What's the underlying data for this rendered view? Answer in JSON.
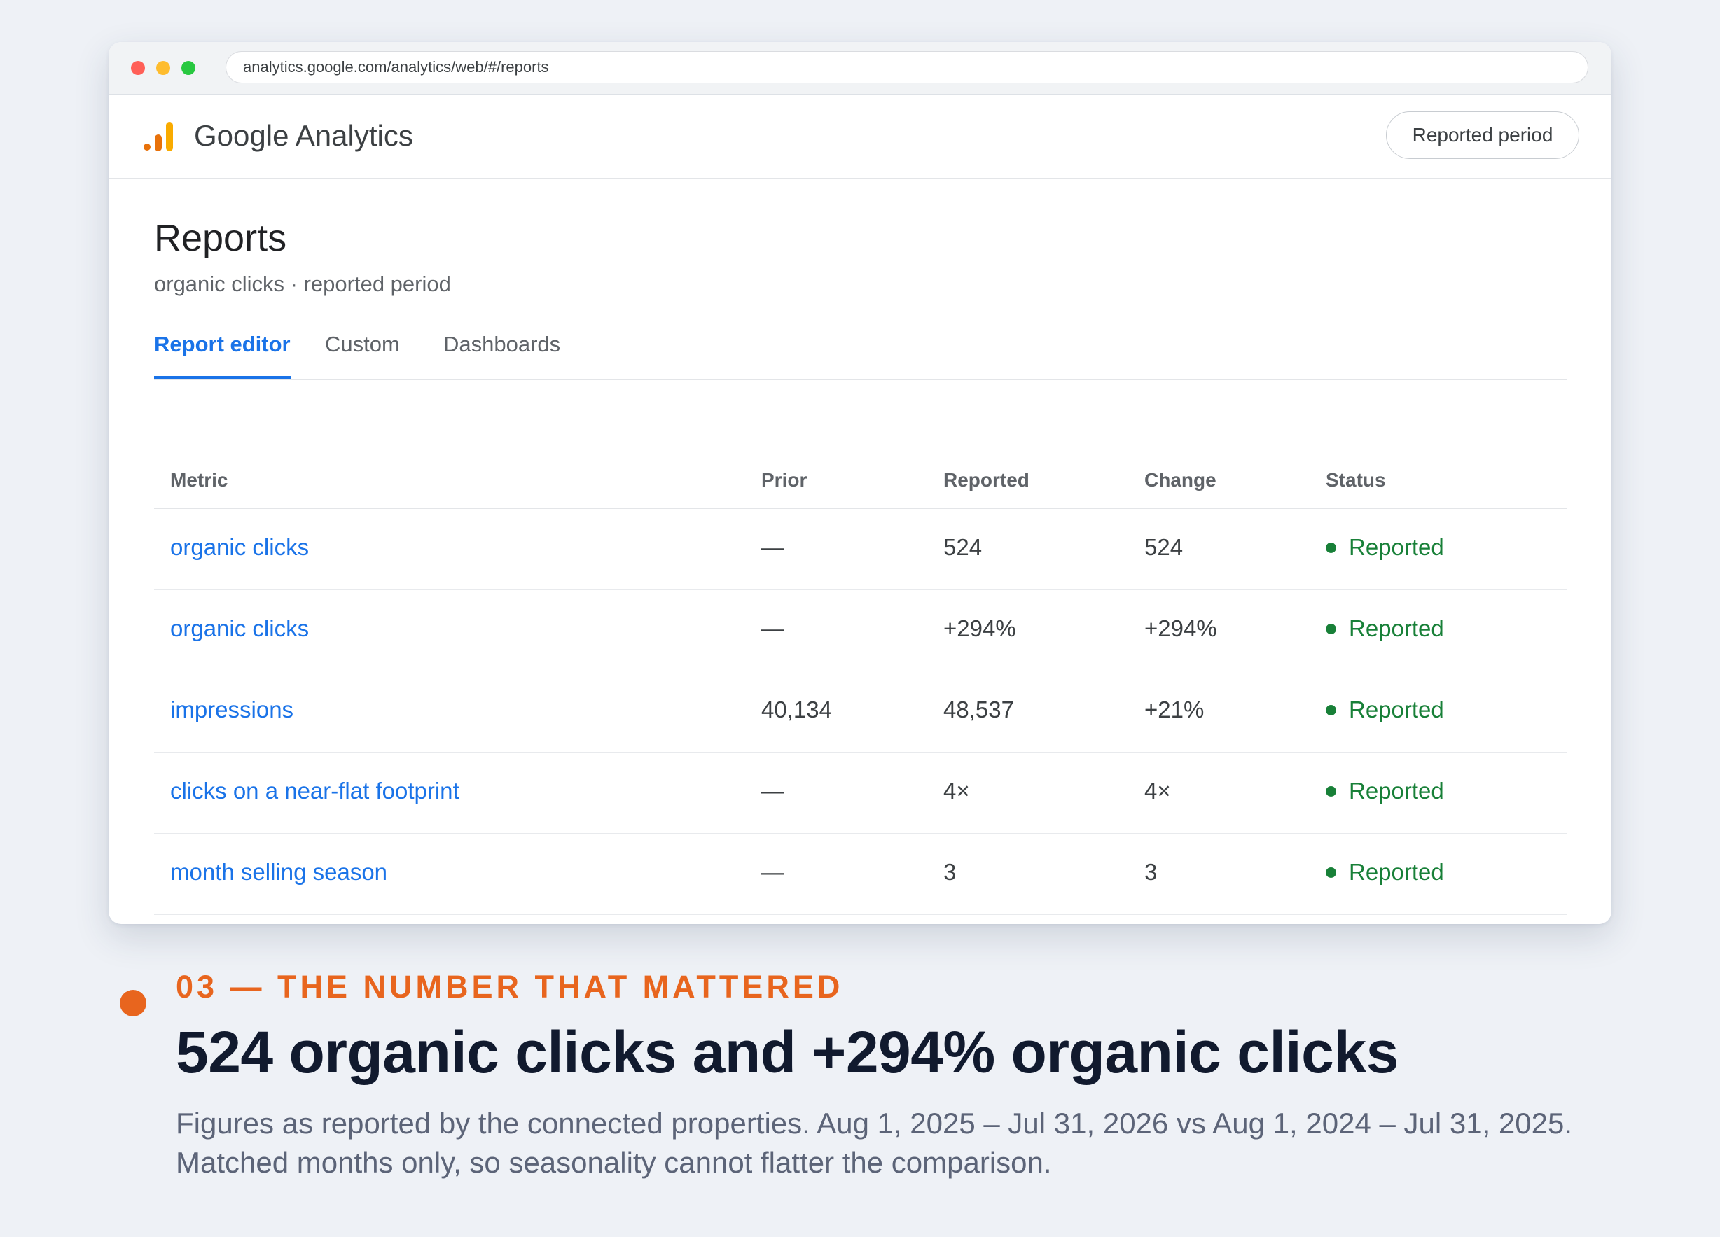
{
  "browser": {
    "url": "analytics.google.com/analytics/web/#/reports"
  },
  "header": {
    "brand": "Google Analytics",
    "period_button": "Reported period"
  },
  "page": {
    "title": "Reports",
    "subtitle": "organic clicks · reported period"
  },
  "tabs": [
    {
      "label": "Report editor",
      "active": true
    },
    {
      "label": "Custom",
      "active": false
    },
    {
      "label": "Dashboards",
      "active": false
    }
  ],
  "table": {
    "columns": [
      "Metric",
      "Prior",
      "Reported",
      "Change",
      "Status"
    ],
    "rows": [
      {
        "metric": "organic clicks",
        "prior": "—",
        "reported": "524",
        "change": "524",
        "status": "Reported"
      },
      {
        "metric": "organic clicks",
        "prior": "—",
        "reported": "+294%",
        "change": "+294%",
        "status": "Reported"
      },
      {
        "metric": "impressions",
        "prior": "40,134",
        "reported": "48,537",
        "change": "+21%",
        "status": "Reported"
      },
      {
        "metric": "clicks on a near-flat footprint",
        "prior": "—",
        "reported": "4×",
        "change": "4×",
        "status": "Reported"
      },
      {
        "metric": "month selling season",
        "prior": "—",
        "reported": "3",
        "change": "3",
        "status": "Reported"
      }
    ]
  },
  "callout": {
    "eyebrow": "03 — THE NUMBER THAT MATTERED",
    "headline": "524 organic clicks and +294% organic clicks",
    "caption": "Figures as reported by the connected properties. Aug 1, 2025 – Jul 31, 2026 vs Aug 1, 2024 – Jul 31, 2025. Matched months only, so seasonality cannot flatter the comparison."
  },
  "colors": {
    "accent": "#1a73e8",
    "status_green": "#188038",
    "callout_orange": "#e8651e",
    "logo_orange": "#e8710a",
    "logo_yellow": "#f9ab00"
  }
}
